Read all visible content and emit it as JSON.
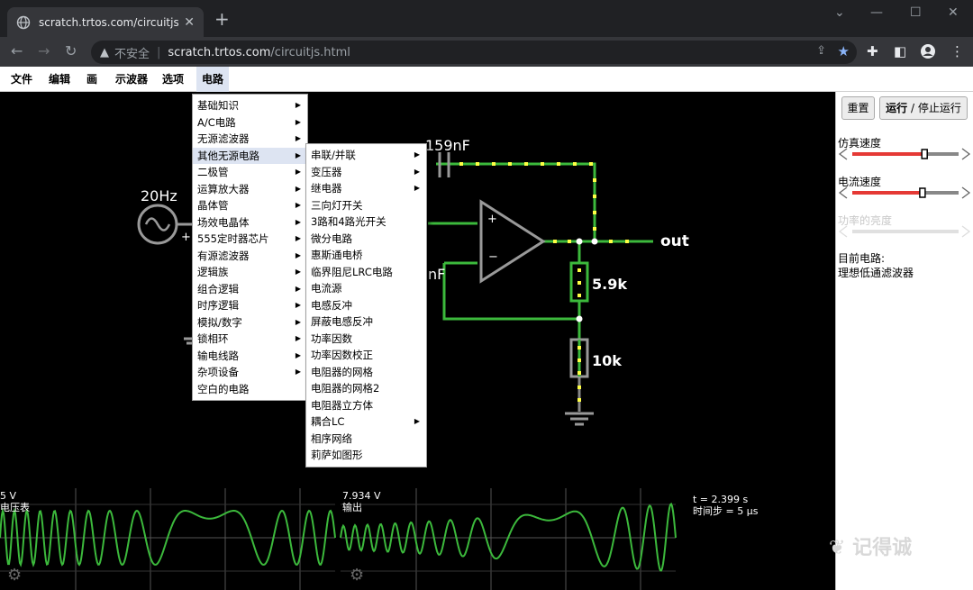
{
  "browser": {
    "tab_title": "scratch.trtos.com/circuitjs.html",
    "new_tab": "+",
    "insecure_label": "不安全",
    "url_host": "scratch.trtos.com",
    "url_path": "/circuitjs.html"
  },
  "menubar": [
    "文件",
    "编辑",
    "画",
    "示波器",
    "选项",
    "电路"
  ],
  "circuit_menu": {
    "items": [
      {
        "label": "基础知识",
        "sub": true
      },
      {
        "label": "A/C电路",
        "sub": true
      },
      {
        "label": "无源滤波器",
        "sub": true
      },
      {
        "label": "其他无源电路",
        "sub": true
      },
      {
        "label": "二极管",
        "sub": true
      },
      {
        "label": "运算放大器",
        "sub": true
      },
      {
        "label": "晶体管",
        "sub": true
      },
      {
        "label": "场效电晶体",
        "sub": true
      },
      {
        "label": "555定时器芯片",
        "sub": true
      },
      {
        "label": "有源滤波器",
        "sub": true
      },
      {
        "label": "逻辑族",
        "sub": true
      },
      {
        "label": "组合逻辑",
        "sub": true
      },
      {
        "label": "时序逻辑",
        "sub": true
      },
      {
        "label": "模拟/数字",
        "sub": true
      },
      {
        "label": "锁相环",
        "sub": true
      },
      {
        "label": "输电线路",
        "sub": true
      },
      {
        "label": "杂项设备",
        "sub": true
      },
      {
        "label": "空白的电路",
        "sub": false
      }
    ],
    "highlighted": 3
  },
  "submenu": {
    "items": [
      {
        "label": "串联/并联",
        "sub": true
      },
      {
        "label": "变压器",
        "sub": true
      },
      {
        "label": "继电器",
        "sub": true
      },
      {
        "label": "三向灯开关",
        "sub": false
      },
      {
        "label": "3路和4路光开关",
        "sub": false
      },
      {
        "label": "微分电路",
        "sub": false
      },
      {
        "label": "惠斯通电桥",
        "sub": false
      },
      {
        "label": "临界阻尼LRC电路",
        "sub": false
      },
      {
        "label": "电流源",
        "sub": false
      },
      {
        "label": "电感反冲",
        "sub": false
      },
      {
        "label": "屏蔽电感反冲",
        "sub": false
      },
      {
        "label": "功率因数",
        "sub": false
      },
      {
        "label": "功率因数校正",
        "sub": false
      },
      {
        "label": "电阻器的网格",
        "sub": false
      },
      {
        "label": "电阻器的网格2",
        "sub": false
      },
      {
        "label": "电阻器立方体",
        "sub": false
      },
      {
        "label": "耦合LC",
        "sub": true
      },
      {
        "label": "相序网络",
        "sub": false
      },
      {
        "label": "莉萨如图形",
        "sub": false
      }
    ]
  },
  "panel": {
    "reset_label": "重置",
    "run_label": "运行",
    "stop_label": " / 停止运行",
    "sim_speed_label": "仿真速度",
    "sim_speed_value": 0.68,
    "current_speed_label": "电流速度",
    "current_speed_value": 0.66,
    "power_label": "功率的亮度",
    "current_circuit_label": "目前电路:",
    "current_circuit_name": "理想低通滤波器"
  },
  "circuit": {
    "source_freq": "20Hz",
    "source_plus": "+",
    "cap_label": "159nF",
    "cap2_label_partial": "nF",
    "out_label": "out",
    "r1_label": "5.9k",
    "r2_label": "10k",
    "opamp_plus": "+",
    "opamp_minus": "−"
  },
  "scopes": [
    {
      "value": "5 V",
      "name": "电压表"
    },
    {
      "value": "7.934 V",
      "name": "输出"
    }
  ],
  "sim_info": {
    "time": "t = 2.399 s",
    "step": "时间步 = 5 μs"
  },
  "watermark": "记得诚",
  "colors": {
    "wire_green": "#3cb93c",
    "current_dot": "#ffff44",
    "slider_red": "#e53935",
    "menu_highlight": "#dde4f2"
  }
}
